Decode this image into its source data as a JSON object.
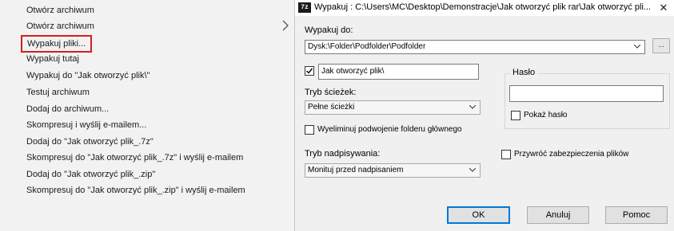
{
  "context_menu": {
    "items": [
      {
        "label": "Otwórz archiwum"
      },
      {
        "label": "Otwórz archiwum"
      },
      {
        "label": "Wypakuj pliki..."
      },
      {
        "label": "Wypakuj tutaj"
      },
      {
        "label": "Wypakuj do \"Jak otworzyć plik\\\""
      },
      {
        "label": "Testuj archiwum"
      },
      {
        "label": "Dodaj do archiwum..."
      },
      {
        "label": "Skompresuj i wyślij e-mailem..."
      },
      {
        "label": "Dodaj do \"Jak otworzyć plik_.7z\""
      },
      {
        "label": "Skompresuj do \"Jak otworzyć plik_.7z\" i wyślij e-mailem"
      },
      {
        "label": "Dodaj do \"Jak otworzyć plik_.zip\""
      },
      {
        "label": "Skompresuj do \"Jak otworzyć plik_.zip\" i wyślij e-mailem"
      }
    ],
    "highlight_color": "#d31f1f",
    "submenu_icon": "chevron-right-icon"
  },
  "dialog": {
    "app_icon_text": "7z",
    "title": "Wypakuj : C:\\Users\\MC\\Desktop\\Demonstracje\\Jak otworzyć plik rar\\Jak otworzyć pli...",
    "close_glyph": "✕",
    "extract_to": {
      "label": "Wypakuj do:",
      "value": "Dysk:\\Folder\\Podfolder\\Podfolder",
      "browse_label": "..."
    },
    "subfolder": {
      "checked": true,
      "value": "Jak otworzyć plik\\"
    },
    "path_mode": {
      "label": "Tryb ścieżek:",
      "value": "Pełne ścieżki"
    },
    "eliminate_duplicates": {
      "checked": false,
      "label": "Wyeliminuj podwojenie folderu głównego"
    },
    "overwrite_mode": {
      "label": "Tryb nadpisywania:",
      "value": "Monituj przed nadpisaniem"
    },
    "password": {
      "group_label": "Hasło",
      "value": "",
      "show_password_label": "Pokaż hasło",
      "show_password_checked": false
    },
    "restore_security": {
      "checked": false,
      "label": "Przywróć zabezpieczenia plików"
    },
    "buttons": {
      "ok": "OK",
      "cancel": "Anuluj",
      "help": "Pomoc"
    },
    "accent_color": "#0078d7"
  }
}
